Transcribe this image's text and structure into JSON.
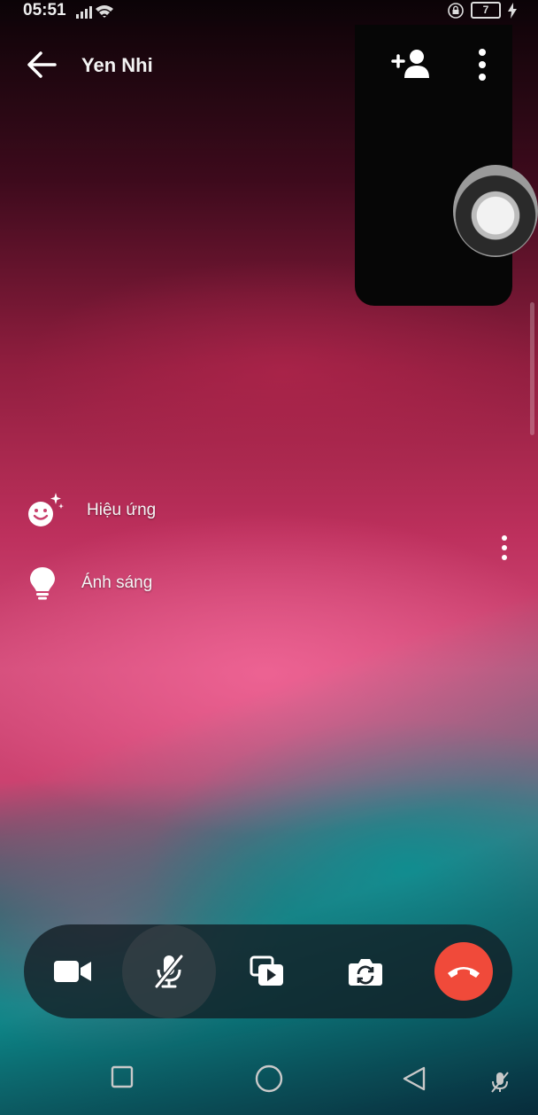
{
  "status_bar": {
    "time": "05:51",
    "battery": "7"
  },
  "header": {
    "contact_name": "Yen Nhi"
  },
  "side_menu": {
    "effects_label": "Hiệu ứng",
    "lighting_label": "Ánh sáng"
  },
  "controls": {
    "items": [
      "video-camera-icon",
      "microphone-muted-icon",
      "share-screen-icon",
      "flip-camera-icon",
      "end-call-icon"
    ],
    "end_call_color": "#f04a3a"
  },
  "navigation": {
    "items": [
      "square-recents-icon",
      "circle-home-icon",
      "triangle-back-icon",
      "microphone-muted-icon"
    ]
  }
}
